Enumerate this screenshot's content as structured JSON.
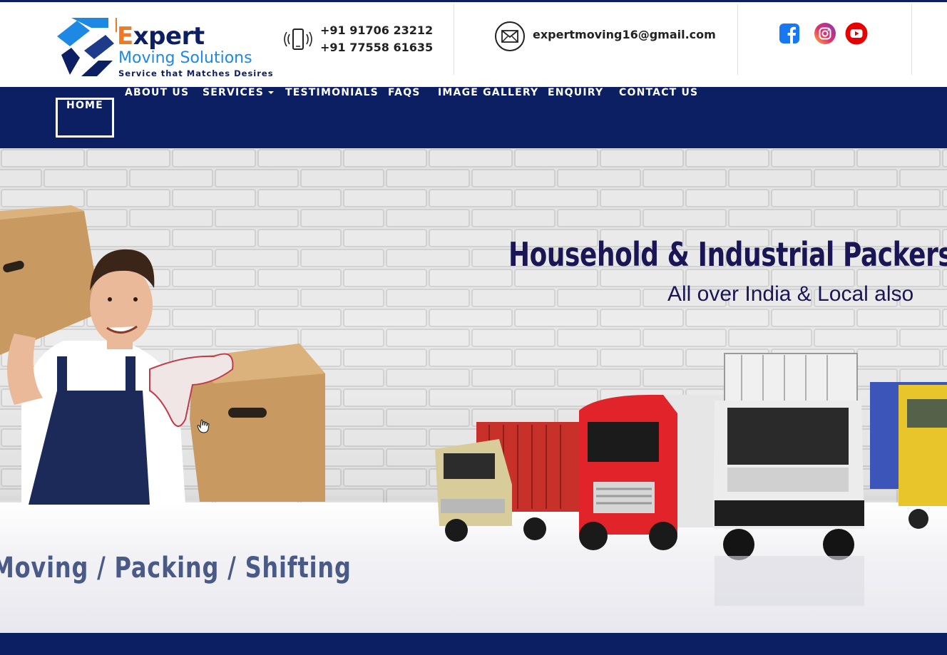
{
  "brand": {
    "title_prefix": "E",
    "title_rest": "xpert",
    "subtitle": "Moving Solutions",
    "tagline": "Service that Matches Desires"
  },
  "contact": {
    "phone1": "+91 91706 23212",
    "phone2": "+91 77558 61635",
    "email": "expertmoving16@gmail.com"
  },
  "social": [
    "facebook-icon",
    "instagram-icon",
    "youtube-icon"
  ],
  "nav": {
    "items": [
      {
        "label": "HOME",
        "active": true
      },
      {
        "label": "ABOUT US"
      },
      {
        "label": "SERVICES",
        "dropdown": true
      },
      {
        "label": "TESTIMONIALS"
      },
      {
        "label": "FAQS"
      },
      {
        "label": "IMAGE GALLERY"
      },
      {
        "label": "ENQUIRY"
      },
      {
        "label": "CONTACT US"
      }
    ]
  },
  "hero": {
    "title": "Household & Industrial Packers and",
    "subtitle": "All over India & Local also",
    "tagline": "Moving  /  Packing  /  Shifting"
  },
  "colors": {
    "navy": "#0d1f63",
    "orange": "#f07a22",
    "blue": "#1e88e5",
    "heading": "#1a1656"
  }
}
